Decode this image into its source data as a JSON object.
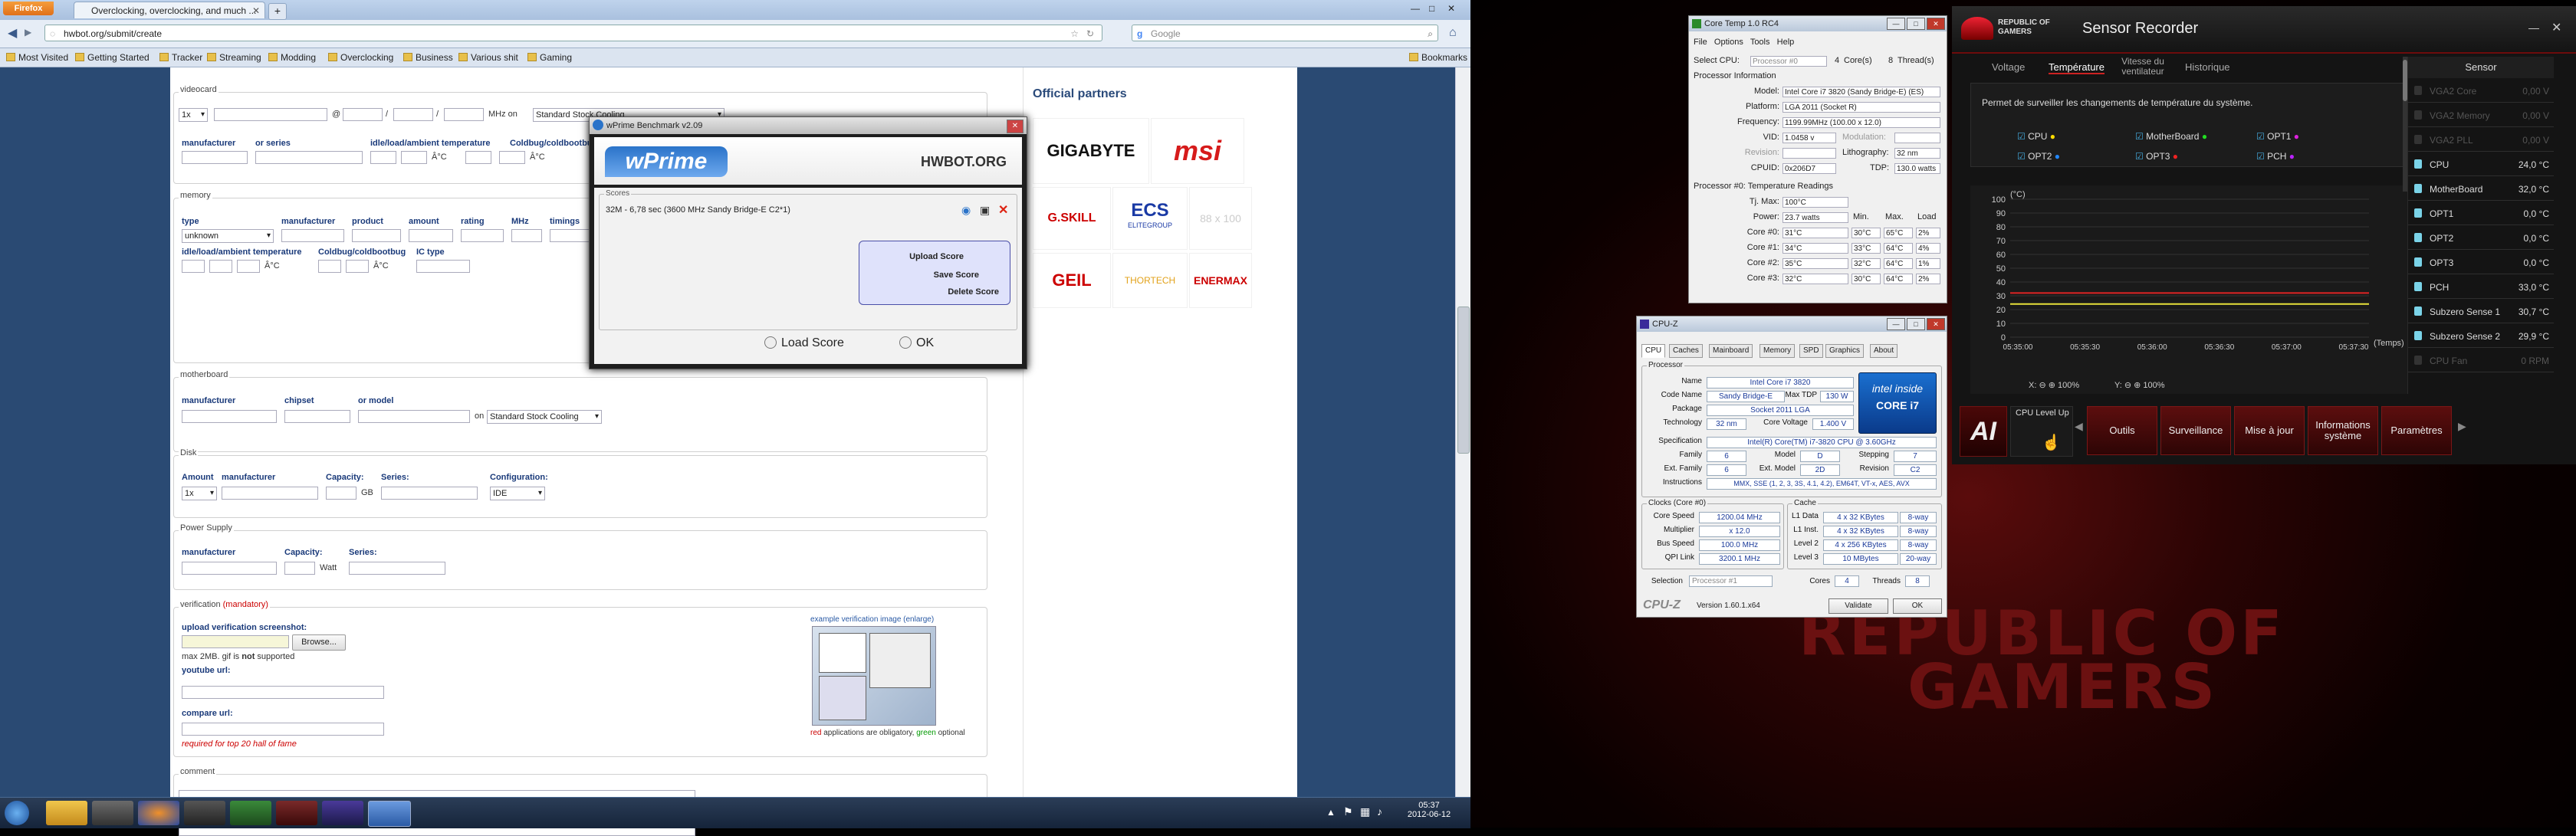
{
  "firefox": {
    "menu_label": "Firefox",
    "tab_title": "Overclocking, overclocking, and much ...",
    "new_tab": "+",
    "url": "hwbot.org/submit/create",
    "search_placeholder": "Google",
    "bookmarks": [
      "Most Visited",
      "Getting Started",
      "Tracker",
      "Streaming",
      "Modding",
      "Overclocking",
      "Business",
      "Various shit",
      "Gaming"
    ],
    "bookmarks_menu": "Bookmarks"
  },
  "form": {
    "videocard": {
      "title": "videocard",
      "count": "1x",
      "at": "@",
      "slash1": "/",
      "slash2": "/",
      "unit": "MHz on",
      "cooling": "Standard Stock Cooling",
      "labels": [
        "manufacturer",
        "or series",
        "idle/load/ambient temperature",
        "Coldbug/coldbootbug"
      ],
      "deg": "Â°C"
    },
    "memory": {
      "title": "memory",
      "labels": [
        "type",
        "manufacturer",
        "product",
        "amount",
        "rating",
        "MHz",
        "timings"
      ],
      "type_value": "unknown",
      "labels2": [
        "idle/load/ambient temperature",
        "Coldbug/coldbootbug",
        "IC type"
      ],
      "deg": "Â°C"
    },
    "motherboard": {
      "title": "motherboard",
      "labels": [
        "manufacturer",
        "chipset",
        "or model"
      ],
      "on": "on",
      "cooling": "Standard Stock Cooling"
    },
    "disk": {
      "title": "Disk",
      "labels": [
        "Amount",
        "manufacturer",
        "Capacity:",
        "Series:",
        "Configuration:"
      ],
      "amount": "1x",
      "unit": "GB",
      "config": "IDE"
    },
    "psu": {
      "title": "Power Supply",
      "labels": [
        "manufacturer",
        "Capacity:",
        "Series:"
      ],
      "unit": "Watt"
    },
    "verification": {
      "title": "verification",
      "mandatory": "(mandatory)",
      "upload_label": "upload verification screenshot:",
      "browse": "Browse...",
      "max_note_1": "max 2MB. gif is ",
      "max_note_not": "not",
      "max_note_2": " supported",
      "youtube": "youtube url:",
      "compare": "compare url:",
      "required": "required for top 20 hall of fame",
      "example": "example verification image (enlarge)",
      "legend_red": "red",
      "legend_mid": " applications are obligatory, ",
      "legend_green": "green",
      "legend_end": " optional"
    },
    "comment": {
      "title": "comment"
    }
  },
  "partners": {
    "title": "Official partners",
    "logos": [
      "GIGABYTE",
      "msi",
      "G.SKILL",
      "ECS",
      "ELITEGROUP",
      "88 x 100",
      "GEIL",
      "THORTECH",
      "ENERMAX"
    ]
  },
  "wprime": {
    "title": "wPrime Benchmark v2.09",
    "logo": "wPrime",
    "hwbot": "HWBOT.ORG",
    "scores_title": "Scores",
    "score_line": "32M - 6,78 sec (3600 MHz Sandy Bridge-E C2*1)",
    "menu": [
      "Upload Score",
      "Save Score",
      "Delete Score"
    ],
    "load": "Load Score",
    "ok": "OK"
  },
  "coretemp": {
    "title": "Core Temp 1.0 RC4",
    "menu": [
      "File",
      "Options",
      "Tools",
      "Help"
    ],
    "select_cpu": "Select CPU:",
    "processor": "Processor #0",
    "cores": "4",
    "cores_label": "Core(s)",
    "threads": "8",
    "threads_label": "Thread(s)",
    "info_title": "Processor Information",
    "fields": [
      {
        "label": "Model:",
        "value": "Intel Core i7 3820 (Sandy Bridge-E) (ES)"
      },
      {
        "label": "Platform:",
        "value": "LGA 2011 (Socket R)"
      },
      {
        "label": "Frequency:",
        "value": "1199.99MHz (100.00 x 12.0)"
      }
    ],
    "vid_label": "VID:",
    "vid": "1.0458 v",
    "mod_label": "Modulation:",
    "rev_label": "Revision:",
    "litho_label": "Lithography:",
    "litho": "32 nm",
    "cpuid_label": "CPUID:",
    "cpuid": "0x206D7",
    "tdp_label": "TDP:",
    "tdp": "130.0 watts",
    "temps_title": "Processor #0: Temperature Readings",
    "tjmax_label": "Tj. Max:",
    "tjmax": "100°C",
    "power_label": "Power:",
    "power": "23.7 watts",
    "cols": [
      "Min.",
      "Max.",
      "Load"
    ],
    "cores_rows": [
      {
        "name": "Core #0:",
        "t": "31°C",
        "min": "30°C",
        "max": "65°C",
        "load": "2%"
      },
      {
        "name": "Core #1:",
        "t": "34°C",
        "min": "33°C",
        "max": "64°C",
        "load": "4%"
      },
      {
        "name": "Core #2:",
        "t": "35°C",
        "min": "32°C",
        "max": "64°C",
        "load": "1%"
      },
      {
        "name": "Core #3:",
        "t": "32°C",
        "min": "30°C",
        "max": "64°C",
        "load": "2%"
      }
    ]
  },
  "cpuz": {
    "title": "CPU-Z",
    "tabs": [
      "CPU",
      "Caches",
      "Mainboard",
      "Memory",
      "SPD",
      "Graphics",
      "About"
    ],
    "processor_title": "Processor",
    "rows": [
      {
        "label": "Name",
        "value": "Intel Core i7 3820"
      },
      {
        "label": "Code Name",
        "value": "Sandy Bridge-E"
      },
      {
        "label": "Package",
        "value": "Socket 2011 LGA"
      },
      {
        "label": "Technology",
        "value": "32 nm"
      }
    ],
    "maxtdp_label": "Max TDP",
    "maxtdp": "130 W",
    "cv_label": "Core Voltage",
    "cv": "1.400 V",
    "spec_label": "Specification",
    "spec": "Intel(R) Core(TM) i7-3820 CPU @ 3.60GHz",
    "family_label": "Family",
    "family": "6",
    "model_label": "Model",
    "model": "D",
    "stepping_label": "Stepping",
    "stepping": "7",
    "extfam_label": "Ext. Family",
    "extfam": "6",
    "extmod_label": "Ext. Model",
    "extmod": "2D",
    "revision_label": "Revision",
    "revision": "C2",
    "instr_label": "Instructions",
    "instr": "MMX, SSE (1, 2, 3, 3S, 4.1, 4.2), EM64T, VT-x, AES, AVX",
    "clocks_title": "Clocks (Core #0)",
    "clocks": [
      {
        "label": "Core Speed",
        "value": "1200.04 MHz"
      },
      {
        "label": "Multiplier",
        "value": "x 12.0"
      },
      {
        "label": "Bus Speed",
        "value": "100.0 MHz"
      },
      {
        "label": "QPI Link",
        "value": "3200.1 MHz"
      }
    ],
    "cache_title": "Cache",
    "cache": [
      {
        "label": "L1 Data",
        "value": "4 x 32 KBytes",
        "way": "8-way"
      },
      {
        "label": "L1 Inst.",
        "value": "4 x 32 KBytes",
        "way": "8-way"
      },
      {
        "label": "Level 2",
        "value": "4 x 256 KBytes",
        "way": "8-way"
      },
      {
        "label": "Level 3",
        "value": "10 MBytes",
        "way": "20-way"
      }
    ],
    "selection_label": "Selection",
    "selection": "Processor #1",
    "cores_label": "Cores",
    "cores": "4",
    "threads_label": "Threads",
    "threads": "8",
    "version": "Version 1.60.1.x64",
    "validate": "Validate",
    "ok": "OK",
    "brand_logo": "CPU-Z",
    "intel_inside": "intel inside",
    "intel_core": "CORE i7"
  },
  "rog": {
    "brand_line1": "REPUBLIC OF",
    "brand_line2": "GAMERS",
    "title": "Sensor Recorder",
    "tabs": [
      "Voltage",
      "Température",
      "Vitesse du ventilateur",
      "Historique"
    ],
    "description": "Permet de surveiller les changements de température du système.",
    "checks": [
      "CPU",
      "MotherBoard",
      "OPT1",
      "OPT2",
      "OPT3",
      "PCH"
    ],
    "chart_unit": "(°C)",
    "time_label": "(Temps)",
    "y_ticks": [
      "100",
      "90",
      "80",
      "70",
      "60",
      "50",
      "40",
      "30",
      "20",
      "10",
      "0"
    ],
    "x_ticks": [
      "05:35:00",
      "05:35:30",
      "05:36:00",
      "05:36:30",
      "05:37:00",
      "05:37:30"
    ],
    "zoom": "100%",
    "sidebar_title": "Sensor",
    "sensors": [
      {
        "name": "VGA2 Core",
        "value": "0,00 V",
        "dim": true
      },
      {
        "name": "VGA2 Memory",
        "value": "0,00 V",
        "dim": true
      },
      {
        "name": "VGA2 PLL",
        "value": "0,00 V",
        "dim": true
      },
      {
        "name": "CPU",
        "value": "24,0 °C"
      },
      {
        "name": "MotherBoard",
        "value": "32,0 °C"
      },
      {
        "name": "OPT1",
        "value": "0,0 °C"
      },
      {
        "name": "OPT2",
        "value": "0,0 °C"
      },
      {
        "name": "OPT3",
        "value": "0,0 °C"
      },
      {
        "name": "PCH",
        "value": "33,0 °C"
      },
      {
        "name": "Subzero Sense 1",
        "value": "30,7 °C"
      },
      {
        "name": "Subzero Sense 2",
        "value": "29,9 °C"
      },
      {
        "name": "CPU Fan",
        "value": "0 RPM",
        "dim": true
      }
    ],
    "level_up": "CPU Level Up",
    "buttons": [
      "Outils",
      "Surveillance",
      "Mise à jour",
      "Informations système",
      "Paramètres"
    ],
    "bg_line1": "REPUBLIC OF",
    "bg_line2": "GAMERS"
  },
  "taskbar": {
    "time": "05:37",
    "date": "2012-06-12"
  }
}
